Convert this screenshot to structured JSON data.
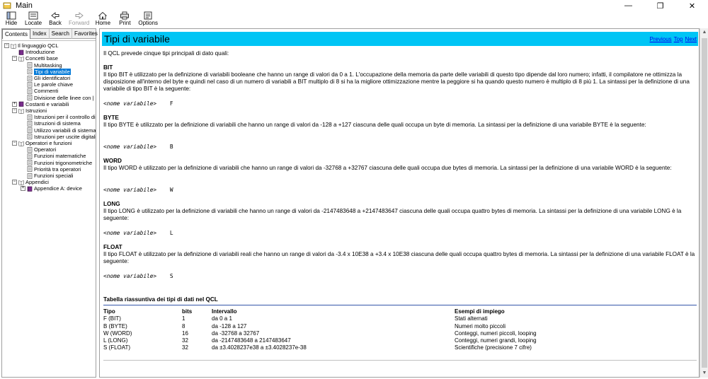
{
  "window": {
    "title": "Main",
    "minimize": "—",
    "maximize": "❐",
    "close": "✕"
  },
  "toolbar": {
    "hide": "Hide",
    "locate": "Locate",
    "back": "Back",
    "forward": "Forward",
    "home": "Home",
    "print": "Print",
    "options": "Options"
  },
  "tabs": [
    "Contents",
    "Index",
    "Search",
    "Favorites"
  ],
  "tree": [
    {
      "label": "Il linguaggio QCL",
      "level": 0,
      "type": "book-open",
      "exp": "−"
    },
    {
      "label": "Introduzione",
      "level": 1,
      "type": "book-closed"
    },
    {
      "label": "Concetti base",
      "level": 1,
      "type": "book-open",
      "exp": "−"
    },
    {
      "label": "Multitasking",
      "level": 2,
      "type": "page"
    },
    {
      "label": "Tipi di variabile",
      "level": 2,
      "type": "page",
      "selected": true
    },
    {
      "label": "Gli identificatori",
      "level": 2,
      "type": "page"
    },
    {
      "label": "Le parole chiave",
      "level": 2,
      "type": "page"
    },
    {
      "label": "Commenti",
      "level": 2,
      "type": "page"
    },
    {
      "label": "Divisione delle linee con |",
      "level": 2,
      "type": "page"
    },
    {
      "label": "Costanti e variabili",
      "level": 1,
      "type": "book-closed",
      "exp": "+"
    },
    {
      "label": "Istruzioni",
      "level": 1,
      "type": "book-open",
      "exp": "−"
    },
    {
      "label": "Istruzioni per il controllo di",
      "level": 2,
      "type": "page"
    },
    {
      "label": "Istruzioni di sistema",
      "level": 2,
      "type": "page"
    },
    {
      "label": "Utilizzo variabili di sistema",
      "level": 2,
      "type": "page"
    },
    {
      "label": "Istruzioni per uscite digitali",
      "level": 2,
      "type": "page"
    },
    {
      "label": "Operatori e funzioni",
      "level": 1,
      "type": "book-open",
      "exp": "−"
    },
    {
      "label": "Operatori",
      "level": 2,
      "type": "page"
    },
    {
      "label": "Funzioni matematiche",
      "level": 2,
      "type": "page"
    },
    {
      "label": "Funzioni trigonometriche",
      "level": 2,
      "type": "page"
    },
    {
      "label": "Priorità tra operatori",
      "level": 2,
      "type": "page"
    },
    {
      "label": "Funzioni speciali",
      "level": 2,
      "type": "page"
    },
    {
      "label": "Appendici",
      "level": 1,
      "type": "book-open",
      "exp": "−"
    },
    {
      "label": "Appendice A: device",
      "level": 2,
      "type": "book-closed",
      "exp": "+"
    }
  ],
  "page": {
    "title": "Tipi di variabile",
    "nav": [
      "Previous",
      "Top",
      "Next"
    ],
    "intro": "Il QCL prevede cinque tipi principali di dato quali:",
    "sections": [
      {
        "heading": "BIT",
        "text": "Il tipo BIT è utilizzato per la definizione di variabili booleane che hanno un range di valori da 0 a 1. L'occupazione della memoria da parte delle variabili di questo tipo dipende dal loro numero; infatti, il compilatore ne ottimizza la disposizione all'interno del byte e quindi nel caso di un numero di variabili a BIT multiplo di 8 si ha la migliore ottimizzazione mentre la peggiore si ha quando questo numero è multiplo di 8 più 1. La sintassi per la definizione di una variabile di tipo BIT è la seguente:",
        "syntax_var": "<nome variabile>",
        "syntax_type": "F"
      },
      {
        "heading": "BYTE",
        "text": "Il tipo BYTE è utilizzato per la definizione di variabili che hanno un range di valori da -128 a +127 ciascuna delle quali occupa un byte di memoria. La sintassi per la definizione di una variabile BYTE è la seguente:",
        "syntax_var": "<nome variabile>",
        "syntax_type": "B"
      },
      {
        "heading": "WORD",
        "text": "Il tipo WORD è utilizzato per la definizione di variabili che hanno un range di valori da -32768 a +32767 ciascuna delle quali occupa due bytes di memoria. La sintassi per la definizione di una variabile WORD è la seguente:",
        "syntax_var": "<nome variabile>",
        "syntax_type": "W"
      },
      {
        "heading": "LONG",
        "text": "Il tipo LONG è utilizzato per la definizione di variabili che hanno un range di valori da -2147483648 a +2147483647 ciascuna delle quali occupa quattro bytes di memoria. La sintassi per la definizione di una variabile LONG è la seguente:",
        "syntax_var": "<nome variabile>",
        "syntax_type": "L"
      },
      {
        "heading": "FLOAT",
        "text": "Il tipo FLOAT è utilizzato per la definizione di variabili reali che hanno un range di valori da -3.4 x 10E38 a +3.4 x 10E38 ciascuna delle quali occupa quattro bytes di memoria. La sintassi per la definizione di una variabile FLOAT è la seguente:",
        "syntax_var": "<nome variabile>",
        "syntax_type": "S"
      }
    ],
    "table_title": "Tabella riassuntiva dei tipi di dati nel QCL",
    "table_headers": [
      "Tipo",
      "bits",
      "Intervallo",
      "Esempi di impiego"
    ],
    "table_rows": [
      [
        "F (BIT)",
        "1",
        "da 0 a 1",
        "Stati alternati"
      ],
      [
        "B (BYTE)",
        "8",
        "da -128 a 127",
        "Numeri molto piccoli"
      ],
      [
        "W (WORD)",
        "16",
        "da -32768 a 32767",
        "Conteggi, numeri piccoli, looping"
      ],
      [
        "L (LONG)",
        "32",
        "da -2147483648 a 2147483647",
        "Conteggi, numeri grandi, looping"
      ],
      [
        "S (FLOAT)",
        "32",
        "da ±3.4028237e38 a ±3.4028237e-38",
        "Scientifiche (precisione 7 cifre)"
      ]
    ]
  },
  "colors": {
    "header": "#00c5f5",
    "selection": "#0078d7",
    "link": "#0000ee"
  }
}
